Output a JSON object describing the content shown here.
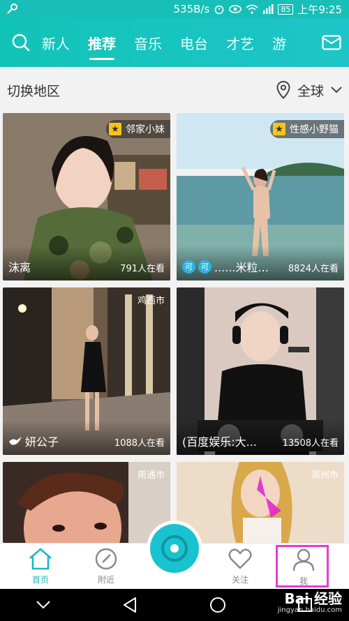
{
  "status_bar": {
    "net_speed": "535B/s",
    "battery": "85",
    "time": "上午9:25"
  },
  "top_nav": {
    "tabs": [
      {
        "label": "新人"
      },
      {
        "label": "推荐"
      },
      {
        "label": "音乐"
      },
      {
        "label": "电台"
      },
      {
        "label": "才艺"
      },
      {
        "label": "游"
      }
    ],
    "active_tab": "推荐"
  },
  "region": {
    "title": "切换地区",
    "value": "全球"
  },
  "cards": [
    {
      "name": "沫离",
      "viewers": "791人在看",
      "badge": "邻家小妹",
      "city": ""
    },
    {
      "name": "......米粒...",
      "viewers": "8824人在看",
      "badge": "性感小野猫",
      "city": "",
      "ke1": "可",
      "ke2": "可"
    },
    {
      "name": "妍公子",
      "viewers": "1088人在看",
      "badge": "",
      "city": "鸡西市"
    },
    {
      "name": "(百度娱乐:大...",
      "viewers": "13508人在看",
      "badge": "",
      "city": ""
    },
    {
      "name": "",
      "viewers": "",
      "badge": "",
      "city": "南通市"
    },
    {
      "name": "",
      "viewers": "",
      "badge": "",
      "city": "滁州市"
    }
  ],
  "bottom_nav": {
    "home": "首页",
    "nearby": "附近",
    "follow": "关注",
    "me": "我"
  },
  "watermark": {
    "text": "Bai 经验",
    "url": "jingyan.baidu.com"
  },
  "colors": {
    "brand": "#17c0bd",
    "active_tab": "#19b8c4",
    "highlight": "#e63ad5"
  }
}
